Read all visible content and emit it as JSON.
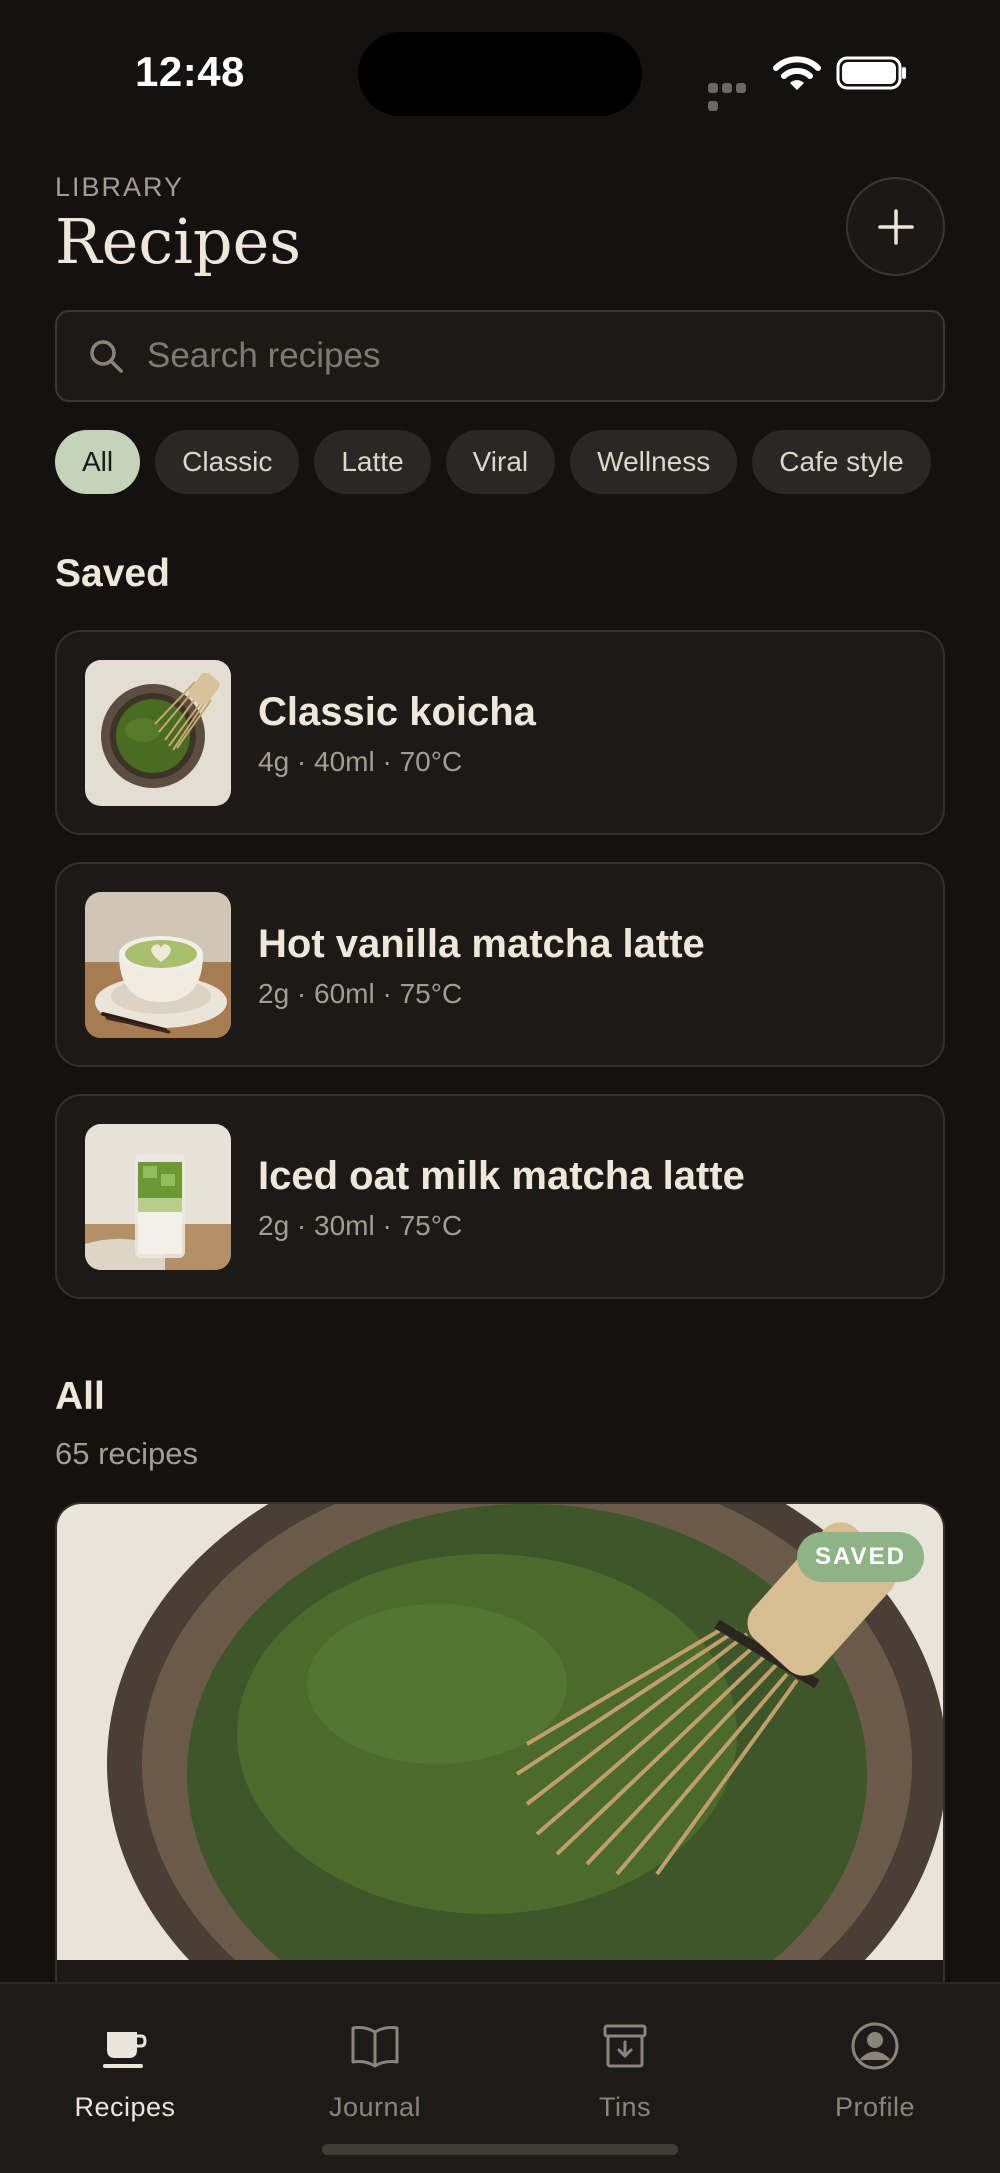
{
  "status_bar": {
    "time": "12:48"
  },
  "header": {
    "eyebrow": "LIBRARY",
    "title": "Recipes"
  },
  "search": {
    "placeholder": "Search recipes",
    "value": ""
  },
  "filters": {
    "chips": [
      "All",
      "Classic",
      "Latte",
      "Viral",
      "Wellness",
      "Cafe style"
    ],
    "selected": "All"
  },
  "saved_section": {
    "title": "Saved",
    "items": [
      {
        "title": "Classic koicha",
        "meta": "4g · 40ml · 70°C",
        "image": "koicha-bowl-image"
      },
      {
        "title": "Hot vanilla matcha latte",
        "meta": "2g · 60ml · 75°C",
        "image": "latte-cup-image"
      },
      {
        "title": "Iced oat milk matcha latte",
        "meta": "2g · 30ml · 75°C",
        "image": "iced-latte-image"
      }
    ]
  },
  "all_section": {
    "title": "All",
    "count_label": "65 recipes",
    "featured": {
      "badge": "SAVED",
      "image": "matcha-bowl-whisk-image"
    }
  },
  "tabbar": {
    "tabs": [
      {
        "label": "Recipes",
        "icon": "cup-icon",
        "active": true
      },
      {
        "label": "Journal",
        "icon": "book-icon",
        "active": false
      },
      {
        "label": "Tins",
        "icon": "tin-icon",
        "active": false
      },
      {
        "label": "Profile",
        "icon": "profile-icon",
        "active": false
      }
    ]
  },
  "colors": {
    "background": "#141210",
    "accent_chip": "#c6d3bb",
    "saved_badge": "#8fb286",
    "text_primary": "#efe8da",
    "text_secondary": "#a49d91"
  }
}
